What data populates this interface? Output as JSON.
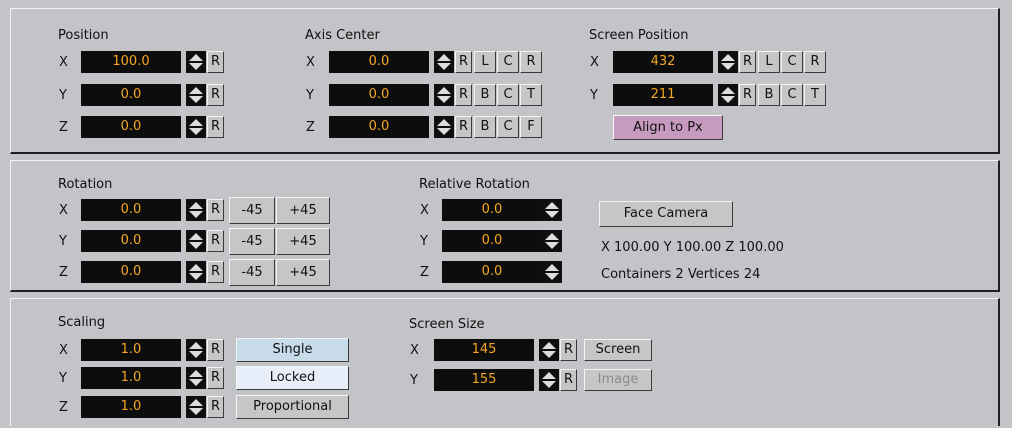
{
  "position": {
    "title": "Position",
    "rows": [
      {
        "axis": "X",
        "value": "100.0",
        "reset": "R"
      },
      {
        "axis": "Y",
        "value": "0.0",
        "reset": "R"
      },
      {
        "axis": "Z",
        "value": "0.0",
        "reset": "R"
      }
    ]
  },
  "axis_center": {
    "title": "Axis Center",
    "rows": [
      {
        "axis": "X",
        "value": "0.0",
        "reset": "R",
        "align": [
          "L",
          "C",
          "R"
        ]
      },
      {
        "axis": "Y",
        "value": "0.0",
        "reset": "R",
        "align": [
          "B",
          "C",
          "T"
        ]
      },
      {
        "axis": "Z",
        "value": "0.0",
        "reset": "R",
        "align": [
          "B",
          "C",
          "F"
        ]
      }
    ]
  },
  "screen_position": {
    "title": "Screen Position",
    "rows": [
      {
        "axis": "X",
        "value": "432",
        "reset": "R",
        "align": [
          "L",
          "C",
          "R"
        ]
      },
      {
        "axis": "Y",
        "value": "211",
        "reset": "R",
        "align": [
          "B",
          "C",
          "T"
        ]
      }
    ],
    "align_button": "Align to Px"
  },
  "rotation": {
    "title": "Rotation",
    "rows": [
      {
        "axis": "X",
        "value": "0.0",
        "reset": "R",
        "minus": "-45",
        "plus": "+45"
      },
      {
        "axis": "Y",
        "value": "0.0",
        "reset": "R",
        "minus": "-45",
        "plus": "+45"
      },
      {
        "axis": "Z",
        "value": "0.0",
        "reset": "R",
        "minus": "-45",
        "plus": "+45"
      }
    ]
  },
  "relative_rotation": {
    "title": "Relative Rotation",
    "rows": [
      {
        "axis": "X",
        "value": "0.0"
      },
      {
        "axis": "Y",
        "value": "0.0"
      },
      {
        "axis": "Z",
        "value": "0.0"
      }
    ]
  },
  "face_camera": {
    "button": "Face Camera",
    "scale_info": "X 100.00  Y 100.00  Z 100.00",
    "counts_info": "Containers 2    Vertices 24"
  },
  "scaling": {
    "title": "Scaling",
    "rows": [
      {
        "axis": "X",
        "value": "1.0",
        "reset": "R"
      },
      {
        "axis": "Y",
        "value": "1.0",
        "reset": "R"
      },
      {
        "axis": "Z",
        "value": "1.0",
        "reset": "R"
      }
    ],
    "modes": [
      "Single",
      "Locked",
      "Proportional"
    ]
  },
  "screen_size": {
    "title": "Screen Size",
    "rows": [
      {
        "axis": "X",
        "value": "145",
        "reset": "R",
        "button": "Screen"
      },
      {
        "axis": "Y",
        "value": "155",
        "reset": "R",
        "button": "Image"
      }
    ]
  },
  "colors": {
    "background": "#c3c4c8",
    "field_bg": "#0d0d0d",
    "field_text": "#f5a623",
    "locked_bg": "#e8effa",
    "single_bg": "#c7dbe8",
    "align_bg": "#c79bbf"
  },
  "icons": {
    "spinner": "up-down-arrow-icon"
  }
}
